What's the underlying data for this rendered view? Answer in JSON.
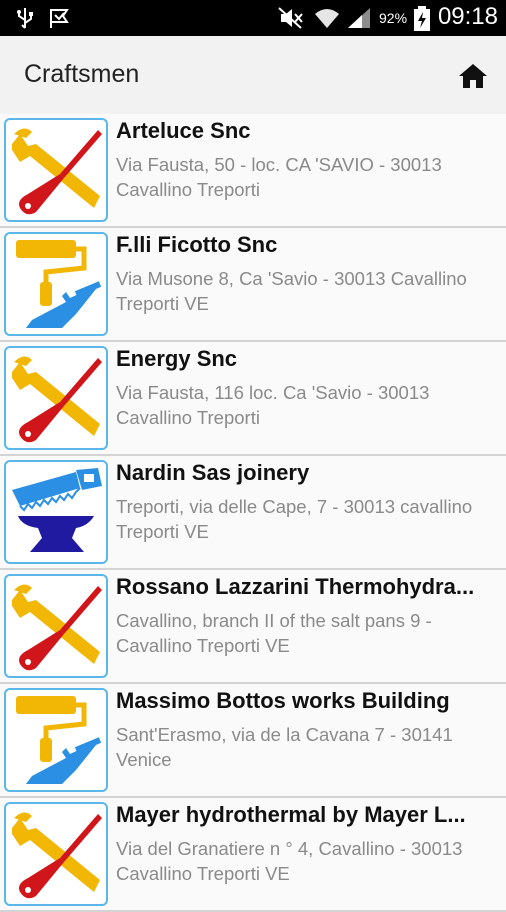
{
  "status_bar": {
    "battery_percent": "92%",
    "time": "09:18"
  },
  "app_bar": {
    "title": "Craftsmen",
    "home_icon": "home-icon"
  },
  "colors": {
    "accent_border": "#5bb7ea",
    "tool_yellow": "#f2b705",
    "tool_red": "#d0161b",
    "tool_blue": "#2b8fe3",
    "anvil_navy": "#1f1aa0"
  },
  "craftsmen": [
    {
      "name": "Arteluce Snc",
      "address": "Via Fausta, 50 - loc. CA 'SAVIO - 30013 Cavallino Treporti",
      "icon": "wrench-screwdriver-icon"
    },
    {
      "name": "F.lli Ficotto Snc",
      "address": "Via Musone 8, Ca 'Savio - 30013 Cavallino Treporti VE",
      "icon": "paint-roller-trowel-icon"
    },
    {
      "name": "Energy Snc",
      "address": "Via Fausta, 116 loc. Ca 'Savio - 30013 Cavallino Treporti",
      "icon": "wrench-screwdriver-icon"
    },
    {
      "name": "Nardin Sas joinery",
      "address": "Treporti, via delle Cape, 7 - 30013 cavallino Treporti VE",
      "icon": "saw-anvil-icon"
    },
    {
      "name": "Rossano Lazzarini Thermohydra...",
      "address": "Cavallino, branch II of the salt pans 9 - Cavallino Treporti VE",
      "icon": "wrench-screwdriver-icon"
    },
    {
      "name": "Massimo Bottos works Building",
      "address": "Sant'Erasmo, via de la Cavana 7 - 30141 Venice",
      "icon": "paint-roller-trowel-icon"
    },
    {
      "name": "Mayer hydrothermal by Mayer L...",
      "address": "Via del Granatiere n ° 4, Cavallino - 30013 Cavallino Treporti VE",
      "icon": "wrench-screwdriver-icon"
    }
  ]
}
